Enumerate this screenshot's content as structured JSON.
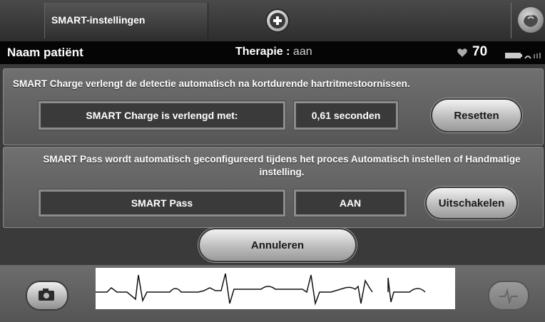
{
  "header": {
    "tab_title": "SMART-instellingen",
    "add_icon": "plus-icon",
    "profile_icon": "patient-heart-icon"
  },
  "status": {
    "patient_name": "Naam patiënt",
    "therapy_label": "Therapie :",
    "therapy_value": "aan",
    "heart_rate": "70",
    "heart_icon": "heart-icon",
    "battery_icon": "battery-icon",
    "signal_icon": "telemetry-icon"
  },
  "smart_charge": {
    "description": "SMART Charge verlengt de detectie automatisch na kortdurende hartritmestoornissen.",
    "label": "SMART Charge is verlengd met:",
    "value": "0,61 seconden",
    "reset_button": "Resetten"
  },
  "smart_pass": {
    "description_line1": "SMART Pass wordt automatisch geconfigureerd tijdens het proces Automatisch instellen of Handmatige",
    "description_line2": "instelling.",
    "label": "SMART Pass",
    "value": "AAN",
    "disable_button": "Uitschakelen"
  },
  "footer": {
    "cancel_button": "Annuleren",
    "camera_icon": "camera-icon",
    "ecg_icon": "ecg-icon"
  },
  "colors": {
    "panel": "#6a6a6a",
    "status_bar": "#050505",
    "button": "#d8d8d8"
  }
}
